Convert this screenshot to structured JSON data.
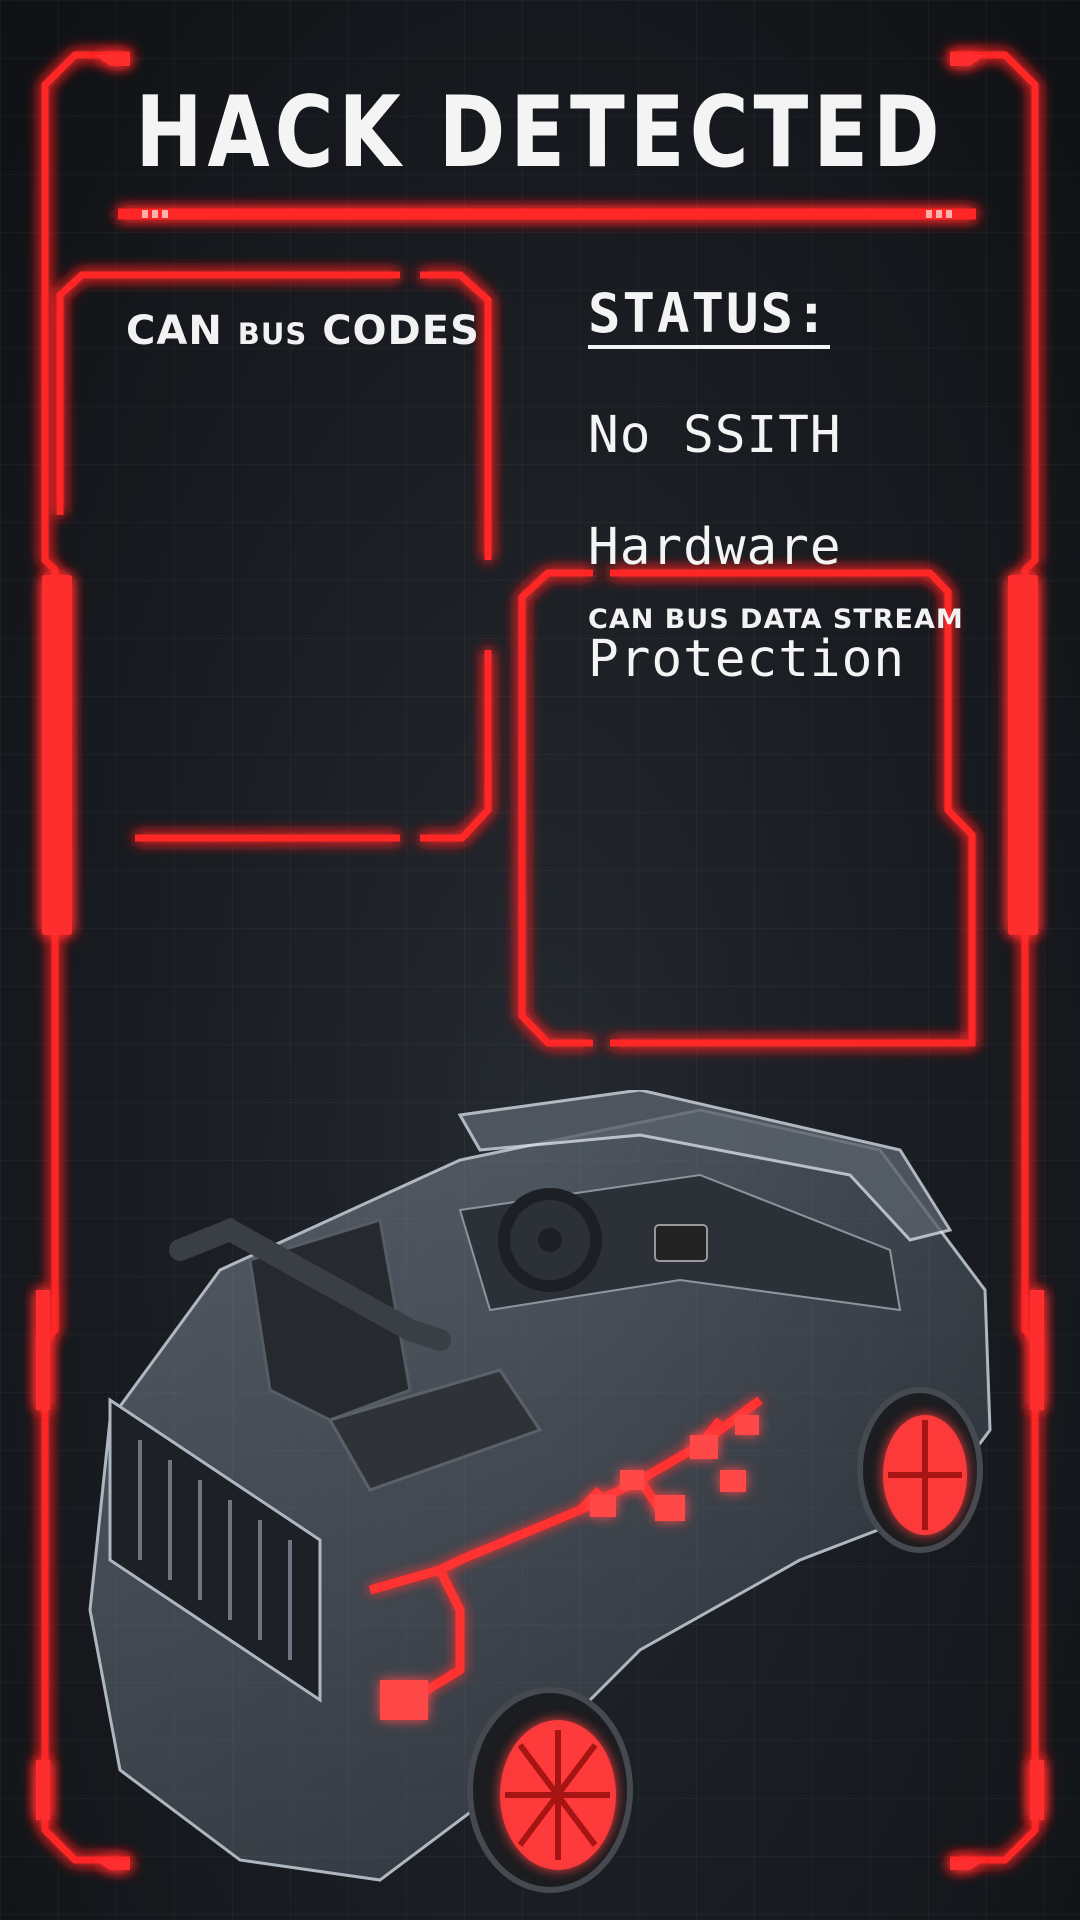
{
  "header": {
    "title": "HACK DETECTED"
  },
  "can_codes_panel": {
    "title_main": "CAN ",
    "title_small": "BUS",
    "title_end": " CODES"
  },
  "status_panel": {
    "label": "STATUS:",
    "lines": [
      "No SSITH",
      "Hardware",
      "Protection"
    ]
  },
  "data_stream_panel": {
    "title": "CAN BUS DATA STREAM"
  },
  "theme": {
    "accent": "#ff2a2a",
    "background": "#15181c",
    "text": "#f4f4f4"
  },
  "vehicle": {
    "icon": "car-xray-icon"
  }
}
